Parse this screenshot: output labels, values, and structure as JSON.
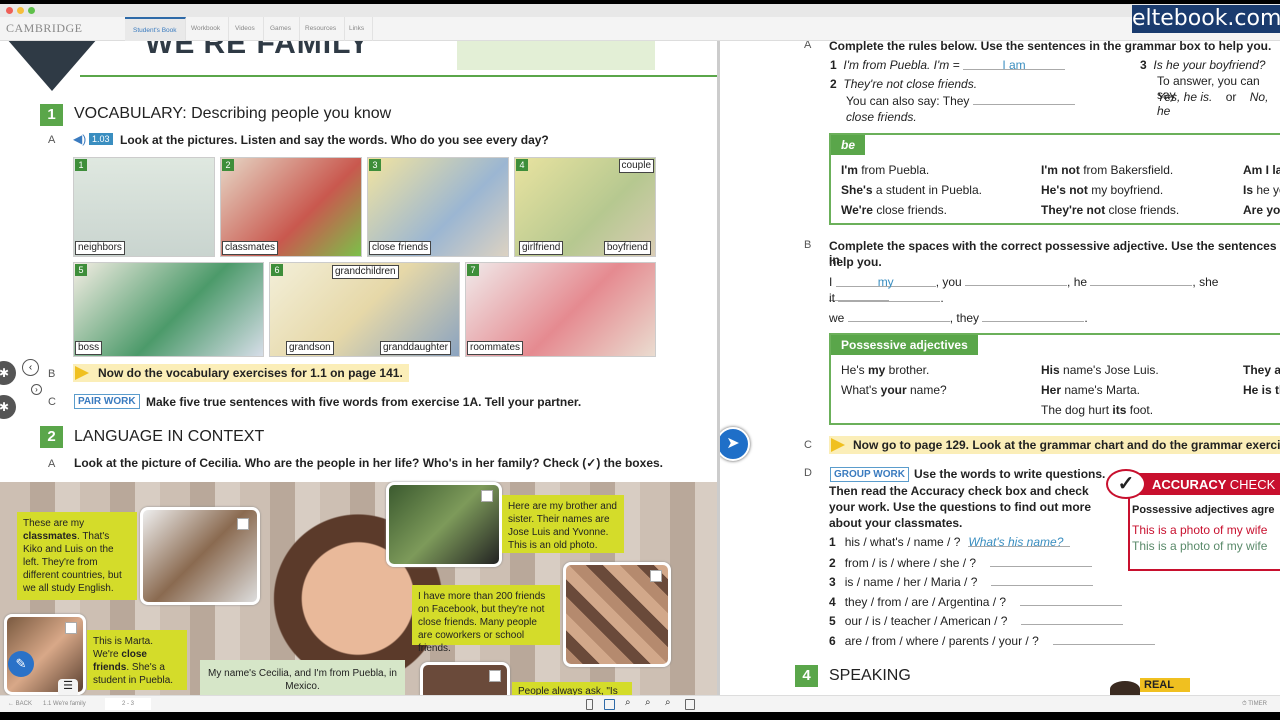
{
  "app": {
    "logo": "CAMBRIDGE",
    "tabs": [
      "Student's Book",
      "Workbook",
      "Videos",
      "Games",
      "Resources",
      "Links"
    ],
    "active_tab": 0,
    "watermark": "eltebook.com"
  },
  "left": {
    "unit_title": "WE'RE FAMILY",
    "s1": {
      "num": "1",
      "title": "VOCABULARY: Describing people you know",
      "a": {
        "letter": "A",
        "audio": "1.03",
        "text": "Look at the pictures. Listen and say the words. Who do you see every day?"
      },
      "pictures": [
        {
          "n": "1",
          "labels": [
            "neighbors"
          ]
        },
        {
          "n": "2",
          "labels": [
            "classmates"
          ]
        },
        {
          "n": "3",
          "labels": [
            "close friends"
          ]
        },
        {
          "n": "4",
          "labels": [
            "girlfriend",
            "boyfriend",
            "couple"
          ]
        },
        {
          "n": "5",
          "labels": [
            "boss"
          ]
        },
        {
          "n": "6",
          "labels": [
            "grandson",
            "granddaughter",
            "grandchildren"
          ]
        },
        {
          "n": "7",
          "labels": [
            "roommates"
          ]
        }
      ],
      "b": {
        "letter": "B",
        "text": "Now do the vocabulary exercises for 1.1 on page 141."
      },
      "c": {
        "letter": "C",
        "badge": "PAIR WORK",
        "text": "Make five true sentences with five words from exercise 1A. Tell your partner."
      }
    },
    "s2": {
      "num": "2",
      "title": "LANGUAGE IN CONTEXT",
      "a": {
        "letter": "A",
        "text": "Look at the picture of Cecilia. Who are the people in her life? Who's in her family? Check (✓) the boxes."
      },
      "bubbles": {
        "classmates": [
          "These are my ",
          "classmates",
          ". That's Kiko and Luis on the left. They're from different countries, but we all study English."
        ],
        "brother": "Here are my brother and sister. Their names are Jose Luis and Yvonne. This is an old photo.",
        "facebook": "I have more than 200 friends on Facebook, but they're not close friends. Many people are coworkers or school friends.",
        "marta": [
          "This is Marta. We're ",
          "close friends",
          ". She's a student in Puebla."
        ],
        "cecilia": "My name's Cecilia, and I'm from Puebla, in Mexico.",
        "people": "People always ask, \"Is he your"
      }
    }
  },
  "right": {
    "a": {
      "letter": "A",
      "text": "Complete the rules below. Use the sentences in the grammar box to help you.",
      "r1": {
        "n": "1",
        "text": "I'm from Puebla.   I'm =",
        "answer": "I am"
      },
      "r2": {
        "n": "2",
        "text": "They're not close friends.",
        "text2": "You can also say:  They",
        "text3": "close friends."
      },
      "r3": {
        "n": "3",
        "text": "Is he your boyfriend?",
        "text2": "To answer, you can say",
        "yes": "Yes, he is.",
        "or": "or",
        "no": "No, he"
      }
    },
    "be_box": {
      "tab": "be",
      "rows": [
        [
          [
            "I'm",
            " from Puebla."
          ],
          [
            "I'm not",
            " from Bakersfield."
          ],
          [
            "Am I la",
            ""
          ]
        ],
        [
          [
            "She's",
            " a student in Puebla."
          ],
          [
            "He's not",
            " my boyfriend."
          ],
          [
            "Is",
            " he yo"
          ]
        ],
        [
          [
            "We're",
            " close friends."
          ],
          [
            "They're not",
            " close friends."
          ],
          [
            "Are yo",
            ""
          ]
        ]
      ]
    },
    "b": {
      "letter": "B",
      "text": "Complete the spaces with the correct possessive adjective. Use the sentences in",
      "text2": "help you.",
      "line1": [
        "I",
        "my",
        ", you",
        ", he",
        ", she"
      ],
      "line2": [
        "it",
        "."
      ],
      "line3": [
        "we",
        ", they",
        "."
      ]
    },
    "poss_box": {
      "tab": "Possessive adjectives",
      "rows": [
        [
          [
            "He's ",
            "my",
            " brother."
          ],
          [
            "",
            "His",
            " name's Jose Luis."
          ],
          [
            "",
            "They a",
            ""
          ]
        ],
        [
          [
            "What's ",
            "your",
            " name?"
          ],
          [
            "",
            "Her",
            " name's Marta."
          ],
          [
            "",
            "He is th",
            ""
          ]
        ],
        [
          [
            "",
            "",
            ""
          ],
          [
            "The dog hurt ",
            "its",
            " foot."
          ],
          [
            "",
            "",
            ""
          ]
        ]
      ]
    },
    "c": {
      "letter": "C",
      "text": "Now go to page 129. Look at the grammar chart and do the grammar exerci"
    },
    "d": {
      "letter": "D",
      "badge": "GROUP WORK",
      "text": "Use the words to write questions.",
      "text2": "Then read the Accuracy check box and check your work. Use the questions to find out more about your classmates.",
      "items": [
        {
          "n": "1",
          "q": "his / what's / name / ?",
          "answer": "What's his name?"
        },
        {
          "n": "2",
          "q": "from / is / where / she / ?"
        },
        {
          "n": "3",
          "q": "is / name / her / Maria / ?"
        },
        {
          "n": "4",
          "q": "they / from / are / Argentina / ?"
        },
        {
          "n": "5",
          "q": "our / is / teacher / American / ?"
        },
        {
          "n": "6",
          "q": "are / from / where / parents / your / ?"
        }
      ]
    },
    "accuracy": {
      "title1": "ACCURACY",
      "title2": "CHECK",
      "lead": "Possessive adjectives agre",
      "wrong": "This is a photo of my wife",
      "right": "This is a photo of my wife"
    },
    "s4": {
      "num": "4",
      "title": "SPEAKING",
      "real": "REAL"
    }
  },
  "bottom": {
    "back": "BACK",
    "section": "1.1 We're family",
    "pages": "2 - 3",
    "timer": "TIMER"
  },
  "colors": {
    "green": "#5aa64a",
    "yellow": "#d4dc2a",
    "red": "#c8102e",
    "blue": "#3a7bbf"
  }
}
